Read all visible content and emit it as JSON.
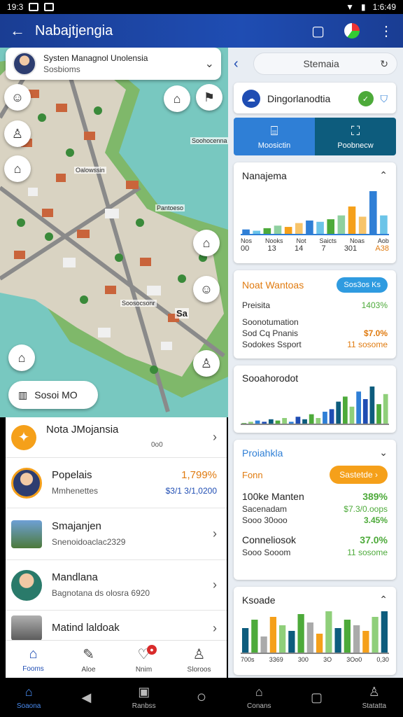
{
  "status_bar": {
    "time_left": "19:3",
    "time_right": "1:6:49"
  },
  "app_bar": {
    "title": "Nabajtjengia"
  },
  "map": {
    "card": {
      "title": "Systen Managnol Unolensia",
      "subtitle": "Sosbioms"
    },
    "labels": [
      "Soohocenna",
      "Oalowssin",
      "Pantoeso",
      "Soosocsonr",
      "Sa"
    ],
    "chip_label": "Sosoi MO"
  },
  "panel": {
    "search_text": "Stemaia",
    "header_card_title": "Dingorlanodtia",
    "tabs": [
      {
        "label": "Moosictin"
      },
      {
        "label": "Poobnecw"
      }
    ],
    "chart1": {
      "title": "Nanajema",
      "categories": [
        "Nos",
        "Nooks",
        "Not",
        "Saicts",
        "Noas",
        "Aob"
      ],
      "values_row": [
        "00",
        "13",
        "14",
        "7",
        "301",
        "A38"
      ]
    },
    "card2": {
      "title": "Noat Wantoas",
      "pill": "Sos3os Ks",
      "rows": [
        {
          "label": "Preisita",
          "value": "1403%"
        },
        {
          "label": "Soonotumation",
          "value": ""
        },
        {
          "label": "Sod Cq Pnanis",
          "value": "$7.0%"
        },
        {
          "label": "Sodokes Ssport",
          "value": "11 sosome"
        }
      ]
    },
    "chart2": {
      "title": "Sooahorodot"
    },
    "card3": {
      "title": "Proiahkla",
      "sub_label": "Fonn",
      "pill": "Sastetde",
      "rows": [
        {
          "label": "100ke Manten",
          "value": "389%"
        },
        {
          "label": "Sacenadam",
          "value": "$7.3/0.oops"
        },
        {
          "label": "Sooo 30ooo",
          "value": "3.45%"
        },
        {
          "label": "Conneliosok",
          "value": "37.0%"
        },
        {
          "label": "Sooo Sooom",
          "value": "11 sosome"
        }
      ]
    },
    "chart3": {
      "title": "Ksoade",
      "categories": [
        "700s",
        "3369",
        "300",
        "3O",
        "3Oo0",
        "0,30"
      ]
    }
  },
  "list": {
    "items": [
      {
        "title": "Nota JMojansia",
        "subtitle": "0o0"
      },
      {
        "title": "Popelais",
        "subtitle": "Mmhenettes",
        "value": "1,799%",
        "value2": "$3/1 3/1,0200"
      },
      {
        "title": "Smajanjen",
        "subtitle": "Snenoidoaclac2329"
      },
      {
        "title": "Mandlana",
        "subtitle": "Bagnotana ds olosra 6920"
      },
      {
        "title": "Matind laldoak",
        "subtitle": ""
      }
    ]
  },
  "bottom_tabs": [
    {
      "label": "Fooms"
    },
    {
      "label": "Aloe"
    },
    {
      "label": "Nnim"
    },
    {
      "label": "Sloroos"
    }
  ],
  "nav_bar": [
    {
      "label": "Soaona"
    },
    {
      "label": ""
    },
    {
      "label": "Ranbss"
    },
    {
      "label": ""
    },
    {
      "label": "Conans"
    },
    {
      "label": ""
    },
    {
      "label": "Statatta"
    }
  ],
  "colors": {
    "app_bar": "#1f4db3",
    "accent_blue": "#2f7fd6",
    "orange": "#f5a01a",
    "green": "#4daa3a",
    "teal": "#0d5c7d"
  },
  "chart_data": [
    {
      "type": "bar",
      "title": "Nanajema",
      "categories": [
        "Nos",
        "Nooks",
        "Not",
        "Saicts",
        "Noas",
        "Aob"
      ],
      "series": [
        {
          "values": [
            4,
            3,
            5,
            7,
            6,
            9,
            11,
            10,
            12,
            15,
            22,
            14,
            34,
            15
          ]
        }
      ]
    },
    {
      "type": "bar",
      "title": "Sooahorodot",
      "series": [
        {
          "values": [
            1,
            2,
            3,
            2,
            4,
            3,
            5,
            2,
            6,
            4,
            8,
            5,
            10,
            12,
            18,
            22,
            14,
            26,
            20,
            30,
            16,
            24
          ]
        }
      ]
    },
    {
      "type": "bar",
      "title": "Ksoade",
      "categories": [
        "700s",
        "3369",
        "300",
        "3O",
        "3Oo0",
        "0,30"
      ],
      "series": [
        {
          "values": [
            18,
            24,
            12,
            26,
            20,
            16,
            28,
            22,
            14,
            30,
            18,
            24,
            20,
            16,
            26,
            30
          ]
        }
      ]
    }
  ]
}
